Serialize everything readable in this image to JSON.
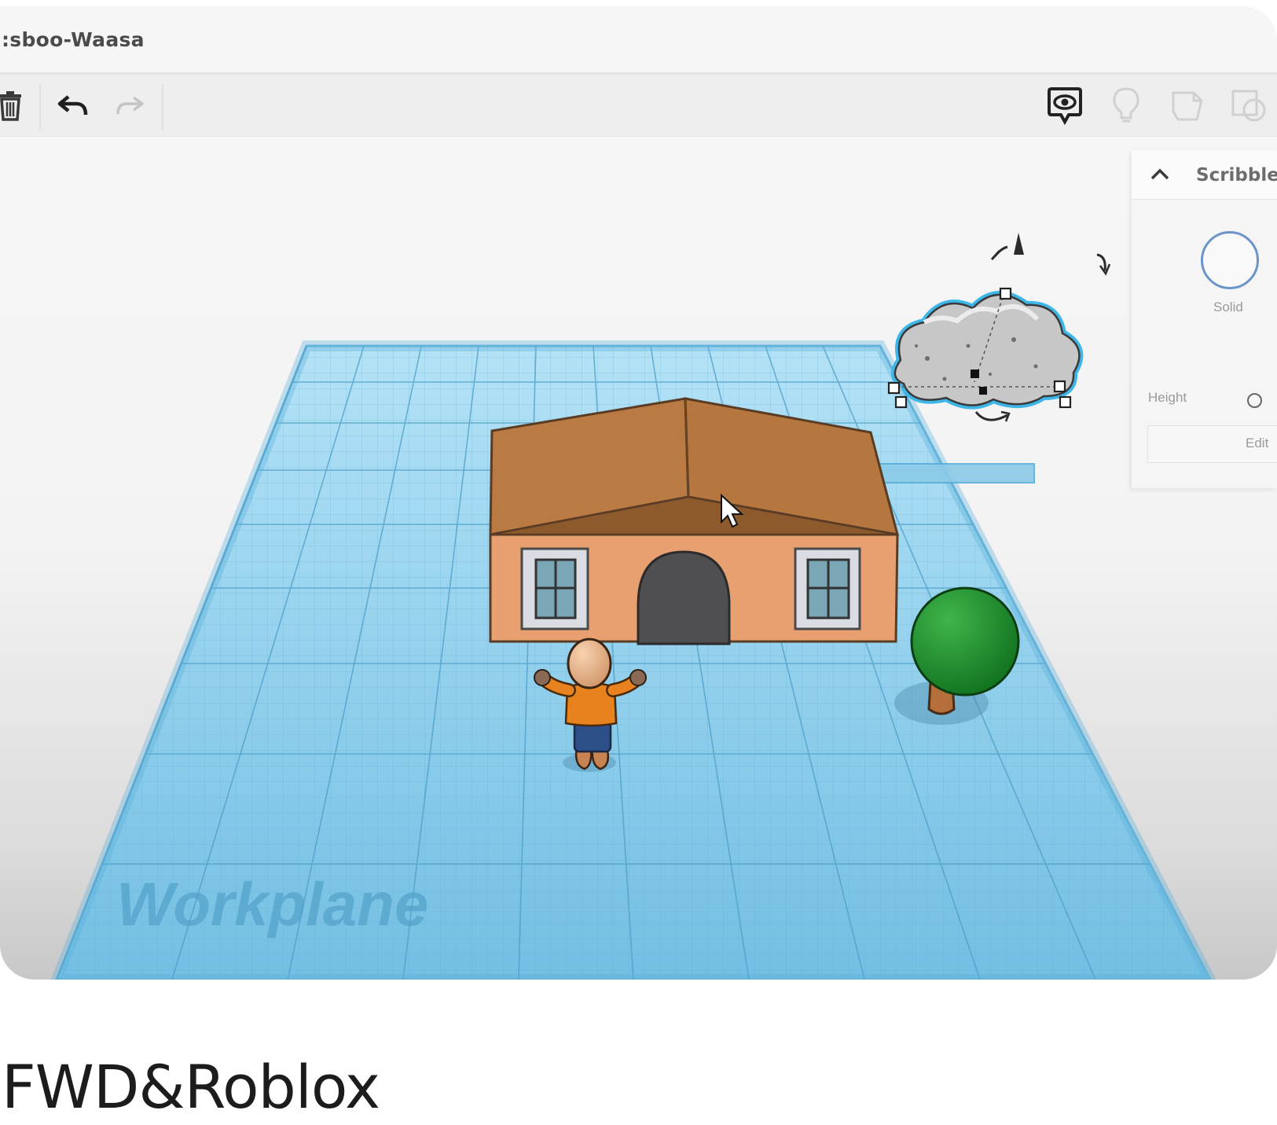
{
  "window": {
    "title": ":sboo-Waasa"
  },
  "toolbar": {
    "delete": "trash-icon",
    "undo": "undo-arrow-icon",
    "redo": "redo-arrow-icon",
    "view_toggle": "eye-speech-icon",
    "hint": "lightbulb-icon",
    "notes": "note-shape-icon",
    "group": "group-shapes-icon"
  },
  "workplane": {
    "label": "Workplane",
    "color": "#7cc8ee"
  },
  "shape_panel": {
    "title": "Scribble",
    "solid_label": "Solid",
    "height_label": "Height",
    "edit_label": "Edit"
  },
  "caption": "FWD&Roblox"
}
